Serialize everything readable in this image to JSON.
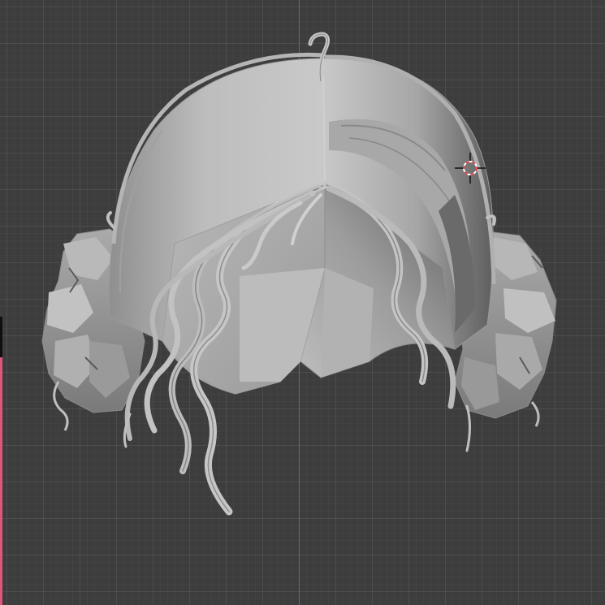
{
  "viewport": {
    "background_color": "#3d3d3d",
    "grid_color": "#4a4a4a",
    "axis_color": "#4a6fa3",
    "accent_edge_color": "#e0557a"
  },
  "model": {
    "icon": "hair-mesh-icon",
    "base_color": "#b4b4b4",
    "shadow_color": "#6e6e6e",
    "highlight_color": "#d2d2d2"
  },
  "cursor": {
    "icon": "3d-cursor-icon",
    "ring_color_a": "#e04040",
    "ring_color_b": "#ffffff"
  }
}
